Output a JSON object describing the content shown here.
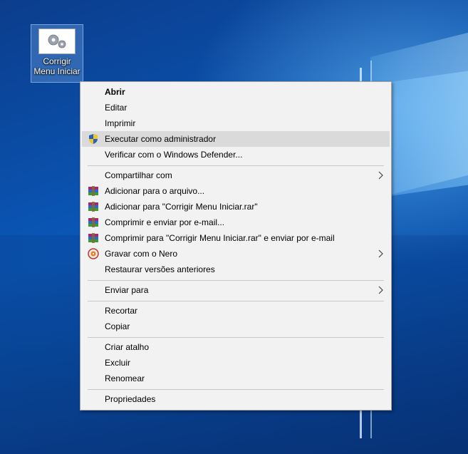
{
  "desktop": {
    "icon_label_line1": "Corrigir",
    "icon_label_line2": "Menu Iniciar"
  },
  "context_menu": {
    "items": [
      {
        "label": "Abrir"
      },
      {
        "label": "Editar"
      },
      {
        "label": "Imprimir"
      },
      {
        "label": "Executar como administrador",
        "icon": "uac-shield-icon"
      },
      {
        "label": "Verificar com o Windows Defender..."
      },
      {
        "label": "Compartilhar com",
        "submenu": true
      },
      {
        "label": "Adicionar para o arquivo...",
        "icon": "winrar-icon"
      },
      {
        "label": "Adicionar para \"Corrigir Menu Iniciar.rar\"",
        "icon": "winrar-icon"
      },
      {
        "label": "Comprimir e enviar por e-mail...",
        "icon": "winrar-icon"
      },
      {
        "label": "Comprimir para \"Corrigir Menu Iniciar.rar\" e enviar por e-mail",
        "icon": "winrar-icon"
      },
      {
        "label": "Gravar com o Nero",
        "icon": "nero-icon",
        "submenu": true
      },
      {
        "label": "Restaurar versões anteriores"
      },
      {
        "label": "Enviar para",
        "submenu": true
      },
      {
        "label": "Recortar"
      },
      {
        "label": "Copiar"
      },
      {
        "label": "Criar atalho"
      },
      {
        "label": "Excluir"
      },
      {
        "label": "Renomear"
      },
      {
        "label": "Propriedades"
      }
    ]
  },
  "colors": {
    "menu_bg": "#f2f2f2",
    "highlight": "#dadada",
    "desktop_blue": "#0a58b8"
  }
}
